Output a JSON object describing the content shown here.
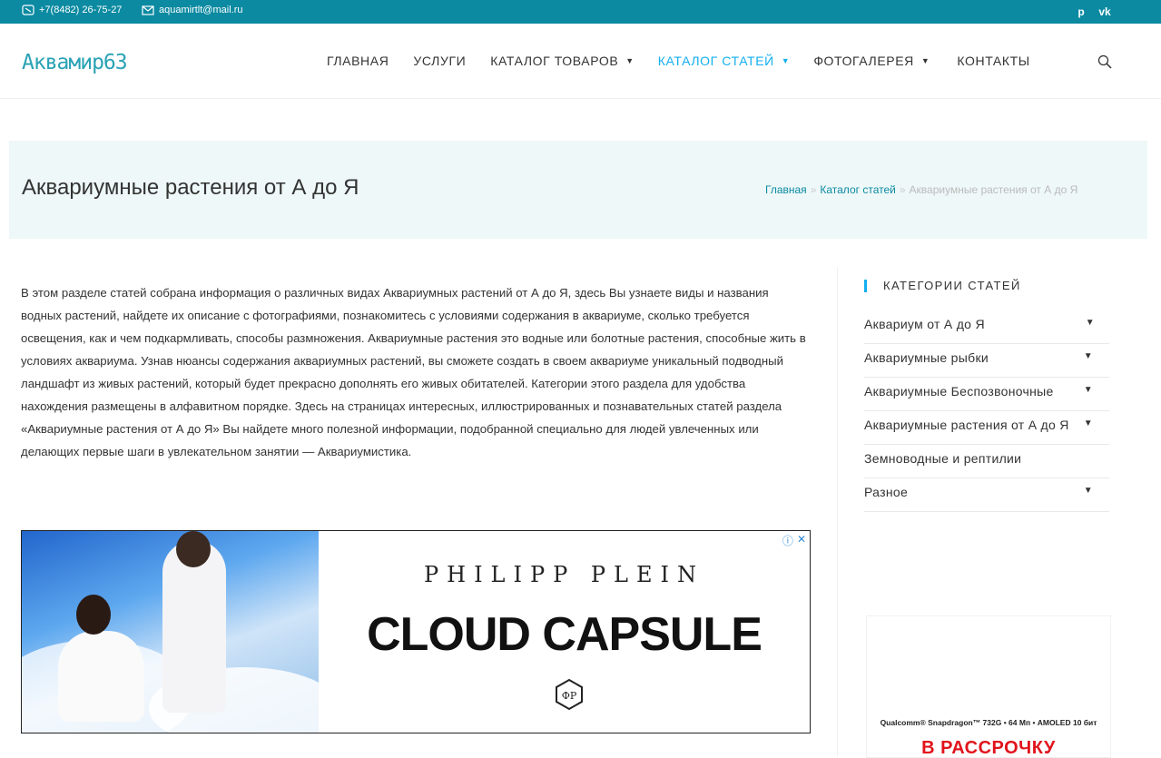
{
  "topbar": {
    "phone": "+7(8482) 26-75-27",
    "email": "aquamirtlt@mail.ru",
    "phone_icon": "phone-icon",
    "email_icon": "envelope-icon",
    "social": [
      {
        "name": "pinterest-icon",
        "glyph": "p"
      },
      {
        "name": "vk-icon",
        "glyph": "vk"
      }
    ],
    "bg_color": "#0b8aa1"
  },
  "header": {
    "logo": "Аквамир63",
    "nav": [
      {
        "label": "Главная",
        "has_dropdown": false,
        "active": false
      },
      {
        "label": "Услуги",
        "has_dropdown": false,
        "active": false
      },
      {
        "label": "Каталог товаров",
        "has_dropdown": true,
        "active": false
      },
      {
        "label": "Каталог статей",
        "has_dropdown": true,
        "active": true
      },
      {
        "label": "Фотогалерея",
        "has_dropdown": true,
        "active": false
      },
      {
        "label": "Контакты",
        "has_dropdown": false,
        "active": false
      }
    ],
    "search_icon": "search-icon",
    "accent_color": "#13aff0"
  },
  "page": {
    "title": "Аквариумные растения от А до Я",
    "breadcrumb": {
      "items": [
        "Главная",
        "Каталог статей"
      ],
      "separator": "»",
      "current": "Аквариумные растения от А до Я"
    }
  },
  "content": {
    "intro": "В этом разделе статей собрана информация о различных видах Аквариумных растений от А до Я, здесь Вы узнаете виды и названия водных растений, найдете их описание с фотографиями, познакомитесь с условиями содержания в аквариуме, сколько требуется освещения, как и чем подкармливать, способы размножения. Аквариумные растения это водные или болотные растения, способные жить в условиях аквариума. Узнав нюансы содержания аквариумных растений, вы сможете создать в своем аквариуме уникальный подводный ландшафт из живых растений, который будет прекрасно дополнять его живых обитателей. Категории этого раздела для удобства нахождения размещены в алфавитном порядке. Здесь на страницах интересных, иллюстрированных и познавательных статей раздела «Аквариумные растения от А до Я» Вы найдете много полезной информации, подобранной специально для людей увлеченных или делающих первые шаги в увлекательном занятии — Аквариумистика."
  },
  "ad": {
    "brand": "PHILIPP PLEIN",
    "headline": "CLOUD CAPSULE",
    "info_icon": "info-icon",
    "close_icon": "close-icon"
  },
  "sidebar": {
    "widget_title": "Категории статей",
    "categories": [
      {
        "label": "Аквариум от А до Я",
        "has_dropdown": true
      },
      {
        "label": "Аквариумные рыбки",
        "has_dropdown": true
      },
      {
        "label": "Аквариумные Беспозвоночные",
        "has_dropdown": true
      },
      {
        "label": "Аквариумные растения от А до Я",
        "has_dropdown": true
      },
      {
        "label": "Земноводные и рептилии",
        "has_dropdown": false
      },
      {
        "label": "Разное",
        "has_dropdown": true
      }
    ],
    "ad": {
      "spec": "Qualcomm® Snapdragon™ 732G • 64 Мп • AMOLED 10 бит",
      "promo": "В РАССРОЧКУ"
    }
  }
}
